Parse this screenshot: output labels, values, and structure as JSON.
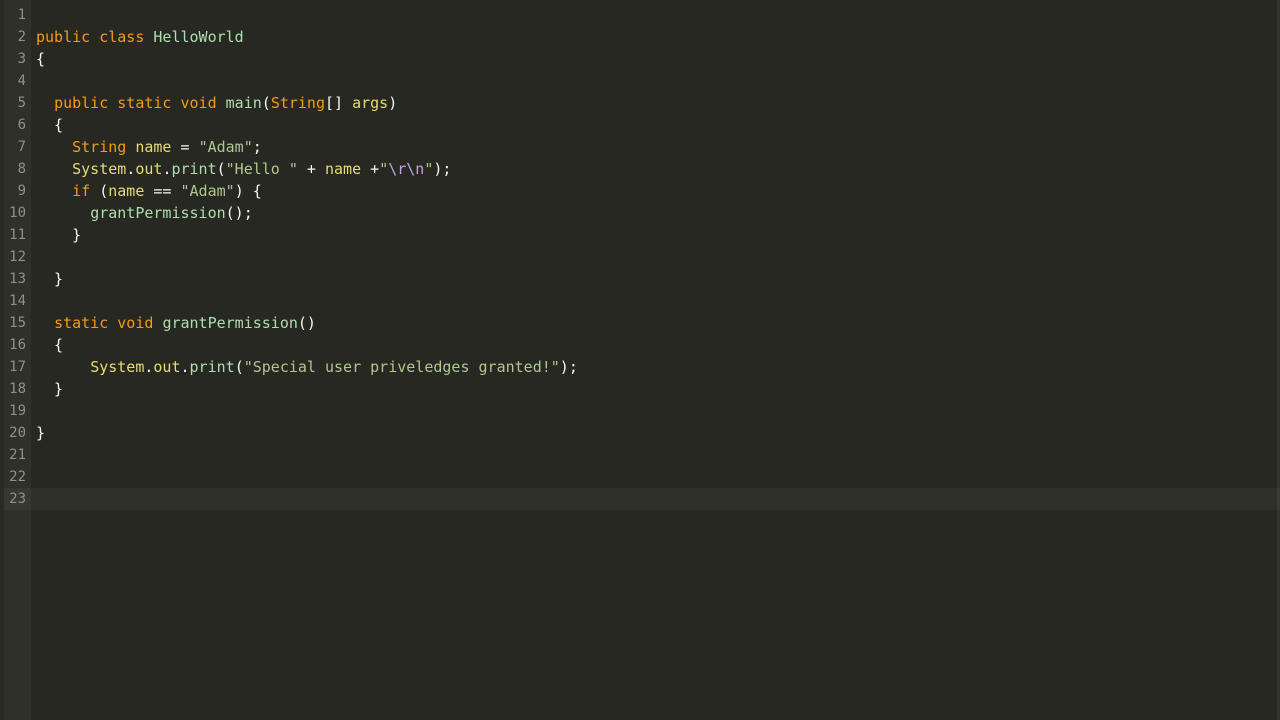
{
  "editor": {
    "line_count": 23,
    "current_line": 23,
    "lines": {
      "2": [
        {
          "t": "public",
          "c": "tok-kw"
        },
        {
          "t": " ",
          "c": "tok-plain"
        },
        {
          "t": "class",
          "c": "tok-kw"
        },
        {
          "t": " ",
          "c": "tok-plain"
        },
        {
          "t": "HelloWorld",
          "c": "tok-class"
        }
      ],
      "3": [
        {
          "t": "{",
          "c": "tok-punc"
        }
      ],
      "5": [
        {
          "t": "  ",
          "c": "tok-plain"
        },
        {
          "t": "public",
          "c": "tok-kw"
        },
        {
          "t": " ",
          "c": "tok-plain"
        },
        {
          "t": "static",
          "c": "tok-kw"
        },
        {
          "t": " ",
          "c": "tok-plain"
        },
        {
          "t": "void",
          "c": "tok-kw"
        },
        {
          "t": " ",
          "c": "tok-plain"
        },
        {
          "t": "main",
          "c": "tok-class"
        },
        {
          "t": "(",
          "c": "tok-punc"
        },
        {
          "t": "String",
          "c": "tok-type"
        },
        {
          "t": "[] ",
          "c": "tok-punc"
        },
        {
          "t": "args",
          "c": "tok-ident"
        },
        {
          "t": ")",
          "c": "tok-punc"
        }
      ],
      "6": [
        {
          "t": "  {",
          "c": "tok-punc"
        }
      ],
      "7": [
        {
          "t": "    ",
          "c": "tok-plain"
        },
        {
          "t": "String",
          "c": "tok-type"
        },
        {
          "t": " ",
          "c": "tok-plain"
        },
        {
          "t": "name",
          "c": "tok-ident"
        },
        {
          "t": " ",
          "c": "tok-plain"
        },
        {
          "t": "=",
          "c": "tok-op"
        },
        {
          "t": " ",
          "c": "tok-plain"
        },
        {
          "t": "\"Adam\"",
          "c": "tok-str"
        },
        {
          "t": ";",
          "c": "tok-punc"
        }
      ],
      "8": [
        {
          "t": "    ",
          "c": "tok-plain"
        },
        {
          "t": "System",
          "c": "tok-ident"
        },
        {
          "t": ".",
          "c": "tok-punc"
        },
        {
          "t": "out",
          "c": "tok-ident"
        },
        {
          "t": ".",
          "c": "tok-punc"
        },
        {
          "t": "print",
          "c": "tok-call"
        },
        {
          "t": "(",
          "c": "tok-punc"
        },
        {
          "t": "\"Hello \"",
          "c": "tok-str"
        },
        {
          "t": " + ",
          "c": "tok-op"
        },
        {
          "t": "name",
          "c": "tok-ident"
        },
        {
          "t": " +",
          "c": "tok-op"
        },
        {
          "t": "\"",
          "c": "tok-str"
        },
        {
          "t": "\\r\\n",
          "c": "tok-esc"
        },
        {
          "t": "\"",
          "c": "tok-str"
        },
        {
          "t": ");",
          "c": "tok-punc"
        }
      ],
      "9": [
        {
          "t": "    ",
          "c": "tok-plain"
        },
        {
          "t": "if",
          "c": "tok-kw"
        },
        {
          "t": " ",
          "c": "tok-plain"
        },
        {
          "t": "(",
          "c": "tok-punc"
        },
        {
          "t": "name",
          "c": "tok-ident"
        },
        {
          "t": " == ",
          "c": "tok-op"
        },
        {
          "t": "\"Adam\"",
          "c": "tok-str"
        },
        {
          "t": ") {",
          "c": "tok-punc"
        }
      ],
      "10": [
        {
          "t": "      ",
          "c": "tok-plain"
        },
        {
          "t": "grantPermission",
          "c": "tok-call"
        },
        {
          "t": "();",
          "c": "tok-punc"
        }
      ],
      "11": [
        {
          "t": "    }",
          "c": "tok-punc"
        }
      ],
      "13": [
        {
          "t": "  }",
          "c": "tok-punc"
        }
      ],
      "15": [
        {
          "t": "  ",
          "c": "tok-plain"
        },
        {
          "t": "static",
          "c": "tok-kw"
        },
        {
          "t": " ",
          "c": "tok-plain"
        },
        {
          "t": "void",
          "c": "tok-kw"
        },
        {
          "t": " ",
          "c": "tok-plain"
        },
        {
          "t": "grantPermission",
          "c": "tok-class"
        },
        {
          "t": "()",
          "c": "tok-punc"
        }
      ],
      "16": [
        {
          "t": "  {",
          "c": "tok-punc"
        }
      ],
      "17": [
        {
          "t": "      ",
          "c": "tok-plain"
        },
        {
          "t": "System",
          "c": "tok-ident"
        },
        {
          "t": ".",
          "c": "tok-punc"
        },
        {
          "t": "out",
          "c": "tok-ident"
        },
        {
          "t": ".",
          "c": "tok-punc"
        },
        {
          "t": "print",
          "c": "tok-call"
        },
        {
          "t": "(",
          "c": "tok-punc"
        },
        {
          "t": "\"Special user priveledges granted!\"",
          "c": "tok-str"
        },
        {
          "t": ");",
          "c": "tok-punc"
        }
      ],
      "18": [
        {
          "t": "  }",
          "c": "tok-punc"
        }
      ],
      "20": [
        {
          "t": "}",
          "c": "tok-punc"
        }
      ]
    }
  }
}
